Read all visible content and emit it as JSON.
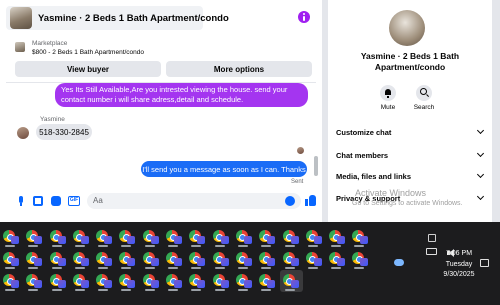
{
  "chat": {
    "title": "Yasmine · 2 Beds 1 Bath Apartment/condo",
    "marketplace_label": "Marketplace",
    "listing": "$800 - 2 Beds 1 Bath Apartment/condo",
    "view_buyer_label": "View buyer",
    "more_options_label": "More options",
    "messages": {
      "outgoing_1": "Yes Its Still Available,Are you intrested viewing the house. send your contact number i will share adress,detail and schedule.",
      "sender_name": "Yasmine",
      "incoming_1": "518-330-2845",
      "outgoing_2": "I'll send you a message as soon as I can. Thanks",
      "status": "Sent"
    },
    "composer_placeholder": "Aa"
  },
  "info_panel": {
    "title": "Yasmine · 2 Beds 1 Bath Apartment/condo",
    "mute_label": "Mute",
    "search_label": "Search",
    "sections": [
      {
        "label": "Customize chat"
      },
      {
        "label": "Chat members"
      },
      {
        "label": "Media, files and links"
      },
      {
        "label": "Privacy & support"
      }
    ]
  },
  "watermark": {
    "line1": "Activate Windows",
    "line2": "Go to Settings to activate Windows."
  },
  "taskbar": {
    "time": "7:06 PM",
    "day": "Tuesday",
    "date": "9/30/2025",
    "app_icon": "chrome-profile-icon",
    "item_count": 45
  },
  "colors": {
    "accent_purple": "#a435f0",
    "accent_blue": "#1a6cf6",
    "messenger_blue": "#0866ff"
  }
}
